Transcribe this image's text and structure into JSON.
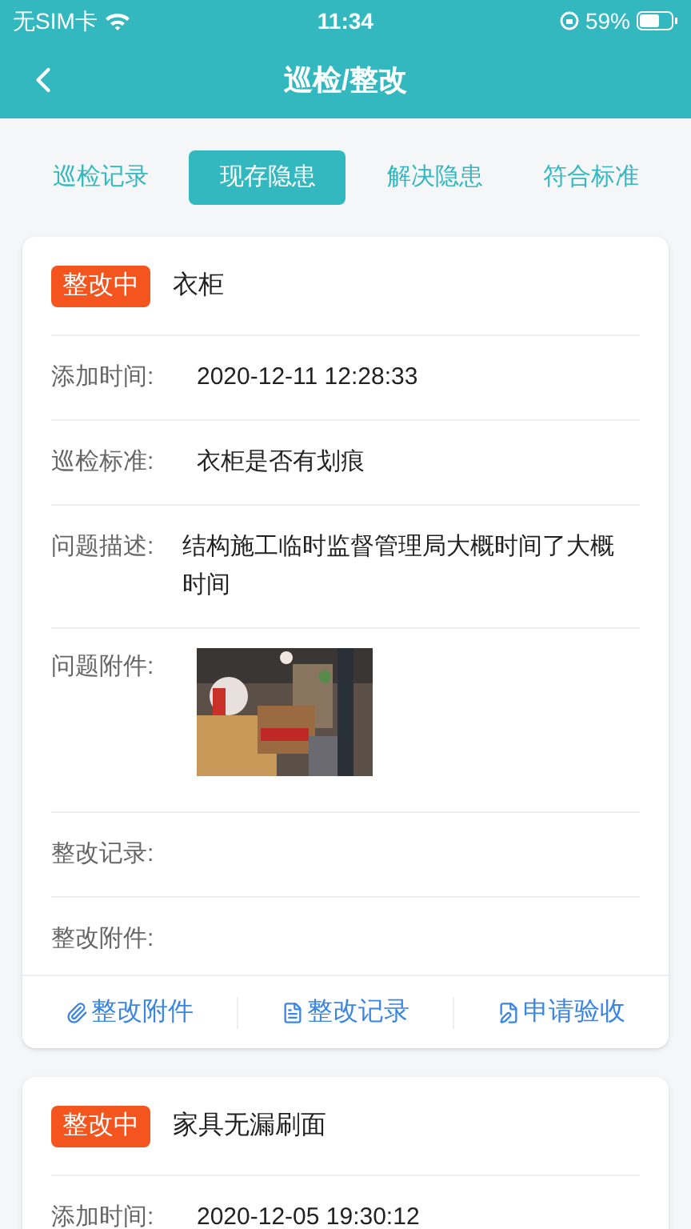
{
  "status_bar": {
    "carrier": "无SIM卡",
    "time": "11:34",
    "battery": "59%"
  },
  "header": {
    "title": "巡检/整改"
  },
  "tabs": [
    {
      "label": "巡检记录",
      "selected": false
    },
    {
      "label": "现存隐患",
      "selected": true
    },
    {
      "label": "解决隐患",
      "selected": false
    },
    {
      "label": "符合标准",
      "selected": false
    }
  ],
  "cards": [
    {
      "status": "整改中",
      "title": "衣柜",
      "fields": [
        {
          "kind": "text",
          "label": "添加时间:",
          "value": "2020-12-11 12:28:33"
        },
        {
          "kind": "text",
          "label": "巡检标准:",
          "value": "衣柜是否有划痕"
        },
        {
          "kind": "text",
          "label": "问题描述:",
          "value": "结构施工临时监督管理局大概时间了大概时间"
        },
        {
          "label": "问题附件:"
        },
        {
          "kind": "text",
          "label": "整改记录:"
        },
        {
          "kind": "text",
          "label": "整改附件:"
        }
      ],
      "actions": [
        {
          "kind": "attach",
          "label": "整改附件"
        },
        {
          "kind": "document",
          "label": "整改记录"
        },
        {
          "kind": "edit",
          "label": "申请验收"
        }
      ]
    },
    {
      "status": "整改中",
      "title": "家具无漏刷面",
      "fields": [
        {
          "kind": "text",
          "label": "添加时间:",
          "value": "2020-12-05 19:30:12"
        }
      ]
    }
  ]
}
